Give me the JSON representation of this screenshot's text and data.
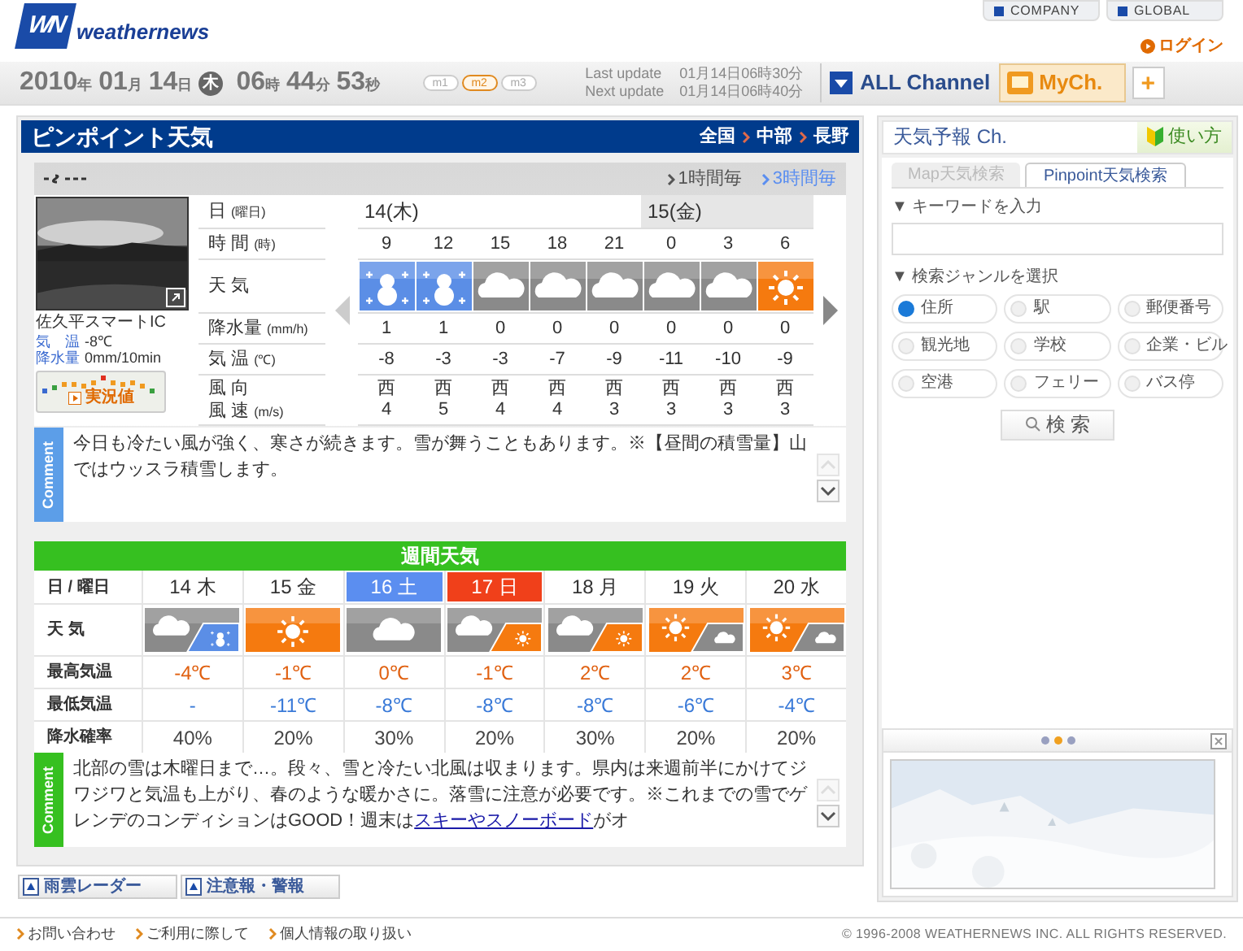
{
  "header": {
    "logo_mark": "WN",
    "logo_text": "weathernews",
    "links": [
      "COMPANY",
      "GLOBAL"
    ],
    "login": "ログイン"
  },
  "clock": {
    "date": [
      {
        "value": "2010",
        "unit": "年"
      },
      {
        "value": "01",
        "unit": "月"
      },
      {
        "value": "14",
        "unit": "日"
      }
    ],
    "weekday": "木",
    "time": [
      {
        "value": "06",
        "unit": "時"
      },
      {
        "value": "44",
        "unit": "分"
      },
      {
        "value": "53",
        "unit": "秒"
      }
    ]
  },
  "modes": [
    {
      "label": "m1",
      "selected": false
    },
    {
      "label": "m2",
      "selected": true
    },
    {
      "label": "m3",
      "selected": false
    }
  ],
  "updates": [
    {
      "label": "Last update",
      "value": "01月14日06時30分"
    },
    {
      "label": "Next update",
      "value": "01月14日06時40分"
    }
  ],
  "channels": {
    "all": "ALL Channel",
    "my": "MyCh.",
    "add": "+"
  },
  "pinpoint": {
    "title": "ピンポイント天気",
    "breadcrumb": [
      "全国",
      "中部",
      "長野"
    ],
    "intervals": [
      {
        "label": "1時間毎",
        "selected": false
      },
      {
        "label": "3時間毎",
        "selected": true
      }
    ],
    "camera": {
      "kind": "picture",
      "place": "佐久平スマートIC",
      "readings": [
        {
          "label": "気　温",
          "value": "-8℃"
        },
        {
          "label": "降水量",
          "value": "0mm/10min"
        }
      ],
      "live_button": "実況値"
    },
    "row_labels": [
      {
        "label": "日",
        "unit": "(曜日)"
      },
      {
        "label": "時 間",
        "unit": "(時)"
      },
      {
        "label": "天 気"
      },
      {
        "label": "降水量",
        "unit": "(mm/h)"
      },
      {
        "label": "気 温",
        "unit": "(℃)"
      },
      {
        "label": "風 向"
      },
      {
        "label": "風 速",
        "unit": "(m/s)"
      }
    ],
    "days": [
      {
        "label": "14(木)",
        "hours": [
          {
            "time": "9",
            "kind": "snow",
            "precip": "1",
            "temp": "-8",
            "wind_dir": "西",
            "wind_speed": "4"
          },
          {
            "time": "12",
            "kind": "snow",
            "precip": "1",
            "temp": "-3",
            "wind_dir": "西",
            "wind_speed": "5"
          },
          {
            "time": "15",
            "kind": "cloudy",
            "precip": "0",
            "temp": "-3",
            "wind_dir": "西",
            "wind_speed": "4"
          },
          {
            "time": "18",
            "kind": "cloudy",
            "precip": "0",
            "temp": "-7",
            "wind_dir": "西",
            "wind_speed": "4"
          },
          {
            "time": "21",
            "kind": "cloudy",
            "precip": "0",
            "temp": "-9",
            "wind_dir": "西",
            "wind_speed": "3"
          }
        ]
      },
      {
        "label": "15(金)",
        "hours": [
          {
            "time": "0",
            "kind": "cloudy",
            "precip": "0",
            "temp": "-11",
            "wind_dir": "西",
            "wind_speed": "3"
          },
          {
            "time": "3",
            "kind": "cloudy",
            "precip": "0",
            "temp": "-10",
            "wind_dir": "西",
            "wind_speed": "3"
          },
          {
            "time": "6",
            "kind": "sunny",
            "precip": "0",
            "temp": "-9",
            "wind_dir": "西",
            "wind_speed": "3"
          }
        ]
      }
    ],
    "comment": {
      "tab": "Comment",
      "text": "今日も冷たい風が強く、寒さが続きます。雪が舞うこともあります。※【昼間の積雪量】山ではウッスラ積雪します。"
    }
  },
  "weekly": {
    "title": "週間天気",
    "header_label": "日 / 曜日",
    "row_labels": [
      "天 気",
      "最高気温",
      "最低気温",
      "降水確率"
    ],
    "days": [
      {
        "label": "14 木",
        "kind": "cloudy_snow",
        "high": "-4℃",
        "low": "-",
        "pop": "40%"
      },
      {
        "label": "15 金",
        "kind": "sunny",
        "high": "-1℃",
        "low": "-11℃",
        "pop": "20%"
      },
      {
        "label": "16 土",
        "color": "#5b8ef0",
        "kind": "cloudy",
        "high": "0℃",
        "low": "-8℃",
        "pop": "30%"
      },
      {
        "label": "17 日",
        "color": "#f0401a",
        "kind": "cloudy_sunny",
        "high": "-1℃",
        "low": "-8℃",
        "pop": "20%"
      },
      {
        "label": "18 月",
        "kind": "cloudy_sunny",
        "high": "2℃",
        "low": "-8℃",
        "pop": "30%"
      },
      {
        "label": "19 火",
        "kind": "sunny_cloudy",
        "high": "2℃",
        "low": "-6℃",
        "pop": "20%"
      },
      {
        "label": "20 水",
        "kind": "sunny_cloudy",
        "high": "3℃",
        "low": "-4℃",
        "pop": "20%"
      }
    ],
    "comment": {
      "tab": "Comment",
      "text": "北部の雪は木曜日まで…。段々、雪と冷たい北風は収まります。県内は来週前半にかけてジワジワと気温も上がり、春のような暖かさに。落雪に注意が必要です。※これまでの雪でゲレンデのコンディションはGOOD！週末は",
      "link": "スキーやスノーボード",
      "text_after": "がオ"
    }
  },
  "bottom_links": [
    "雨雲レーダー",
    "注意報・警報"
  ],
  "sidebar": {
    "title": "天気予報 Ch.",
    "help": "使い方",
    "tabs": [
      {
        "label": "Map天気検索",
        "selected": false
      },
      {
        "label": "Pinpoint天気検索",
        "selected": true
      }
    ],
    "keyword_label": "▼ キーワードを入力",
    "genre_label": "▼ 検索ジャンルを選択",
    "genres": [
      {
        "label": "住所",
        "selected": true
      },
      {
        "label": "駅",
        "selected": false
      },
      {
        "label": "郵便番号",
        "selected": false
      },
      {
        "label": "観光地",
        "selected": false
      },
      {
        "label": "学校",
        "selected": false
      },
      {
        "label": "企業・ビル",
        "selected": false
      },
      {
        "label": "空港",
        "selected": false
      },
      {
        "label": "フェリー",
        "selected": false
      },
      {
        "label": "バス停",
        "selected": false
      }
    ],
    "search_button": "検 索",
    "carousel_dots": [
      {
        "selected": false
      },
      {
        "selected": true
      },
      {
        "selected": false
      }
    ]
  },
  "footer": {
    "links": [
      "お問い合わせ",
      "ご利用に際して",
      "個人情報の取り扱い"
    ],
    "copyright": "© 1996-2008 WEATHERNEWS INC. ALL RIGHTS RESERVED."
  }
}
